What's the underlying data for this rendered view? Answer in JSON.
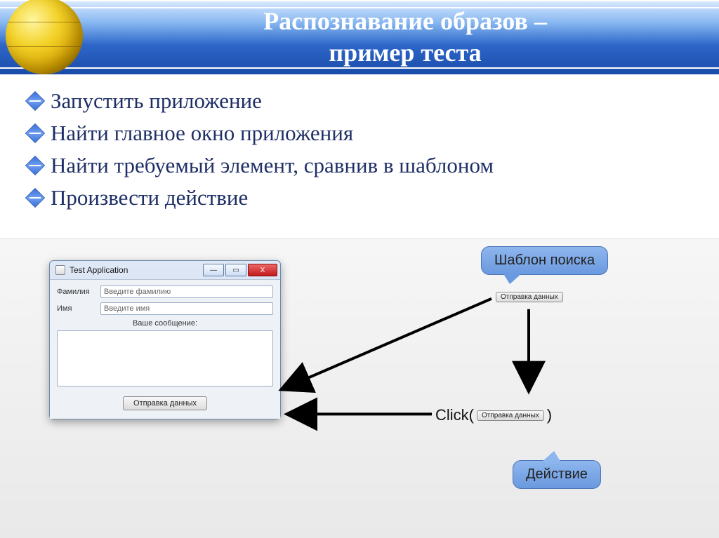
{
  "header": {
    "title_line1": "Распознавание образов –",
    "title_line2": "пример теста"
  },
  "bullets": [
    "Запустить приложение",
    "Найти главное окно приложения",
    "Найти требуемый элемент, сравнив в шаблоном",
    "Произвести действие"
  ],
  "window": {
    "title": "Test Application",
    "label_surname": "Фамилия",
    "placeholder_surname": "Введите фамилию",
    "label_name": "Имя",
    "placeholder_name": "Введите имя",
    "message_label": "Ваше сообщение:",
    "send_button": "Отправка данных",
    "min": "—",
    "max": "▭",
    "close": "X"
  },
  "diagram": {
    "template_callout": "Шаблон поиска",
    "template_button": "Отправка данных",
    "click_prefix": "Click(",
    "click_button": "Отправка данных",
    "click_suffix": ")",
    "action_callout": "Действие"
  }
}
